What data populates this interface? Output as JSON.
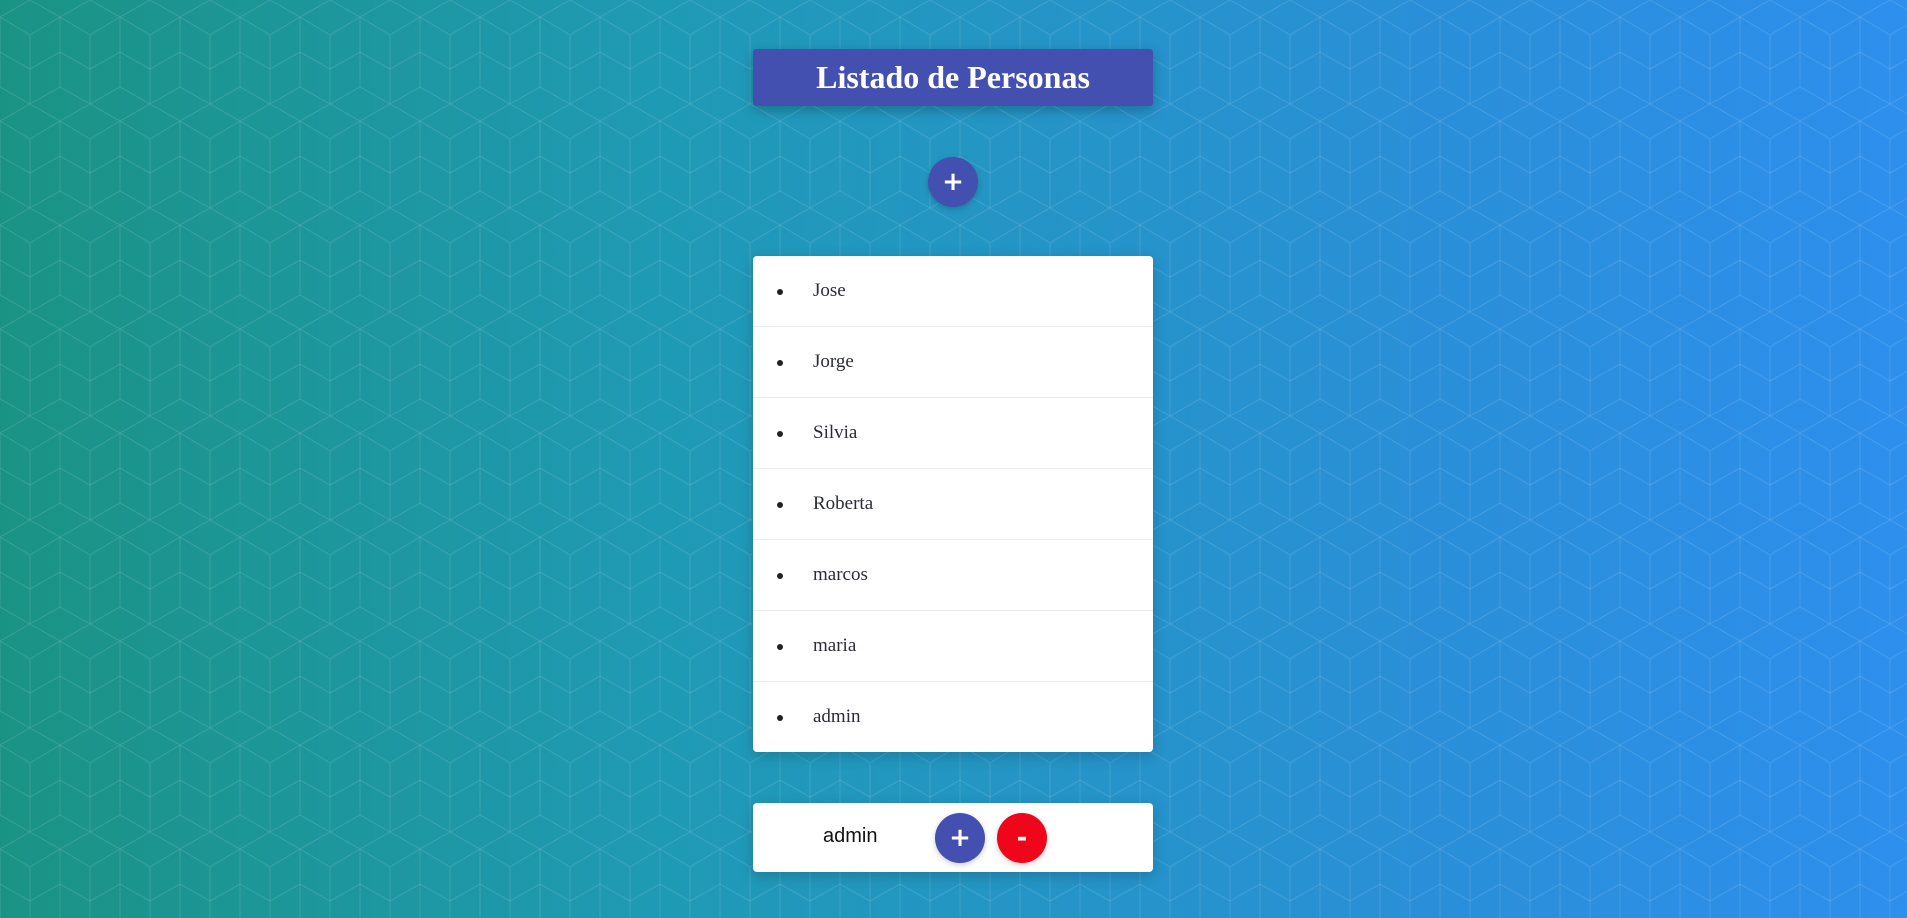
{
  "header": {
    "title": "Listado de Personas"
  },
  "toolbar": {
    "add_label": "+"
  },
  "people": [
    "Jose",
    "Jorge",
    "Silvia",
    "Roberta",
    "marcos",
    "maria",
    "admin"
  ],
  "footer": {
    "selected_user": "admin",
    "add_label": "+",
    "remove_label": "-"
  },
  "colors": {
    "primary": "#4450b0",
    "danger": "#f0061b",
    "background_start": "#1b9384",
    "background_end": "#2e8fed"
  }
}
